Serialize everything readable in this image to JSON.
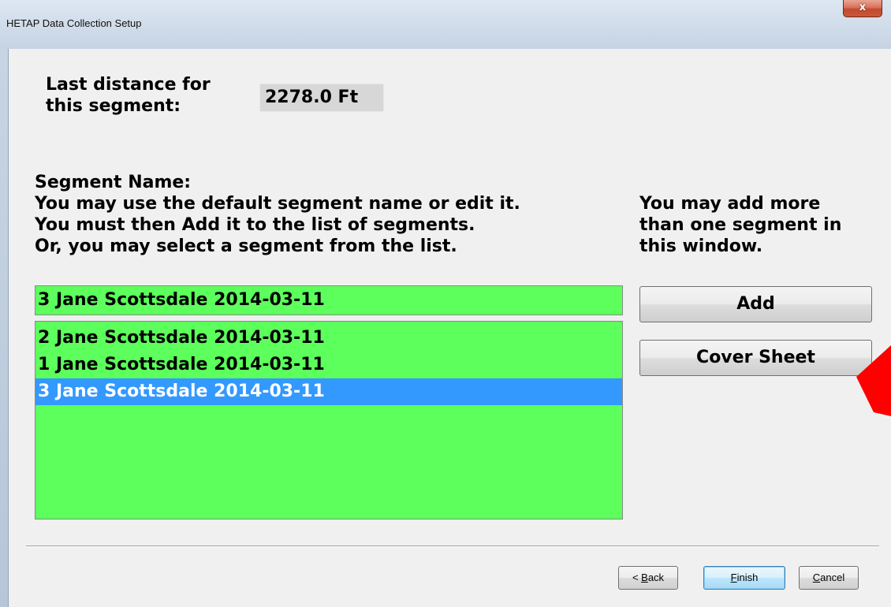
{
  "window": {
    "title": "HETAP Data Collection Setup",
    "close_glyph": "x"
  },
  "distance": {
    "label_line1": "Last distance for",
    "label_line2": "this segment:",
    "value": "2278.0 Ft"
  },
  "segment": {
    "heading": "Segment Name:",
    "instruction_line1": "You may use the default segment name or edit it.",
    "instruction_line2": "You must then Add it to the list of segments.",
    "instruction_line3": "Or, you may select a segment from the list.",
    "input_value": "3 Jane Scottsdale 2014-03-11",
    "list_items": [
      "2 Jane Scottsdale 2014-03-11",
      "1 Jane Scottsdale 2014-03-11",
      "3 Jane Scottsdale 2014-03-11"
    ],
    "selected_index": 2
  },
  "side_note": {
    "line1": "You may add more",
    "line2": "than one segment in",
    "line3": "this window."
  },
  "buttons": {
    "add": "Add",
    "cover_sheet": "Cover Sheet",
    "back_prefix": "< ",
    "back_accel": "B",
    "back_rest": "ack",
    "finish_accel": "F",
    "finish_rest": "inish",
    "cancel_accel": "C",
    "cancel_rest": "ancel"
  },
  "colors": {
    "segment_field_bg": "#5cff5c",
    "selection_bg": "#3399ff",
    "annotation_arrow": "#ff0000"
  },
  "icons": {
    "annotation": "red-arrow-icon",
    "close": "close-icon"
  }
}
